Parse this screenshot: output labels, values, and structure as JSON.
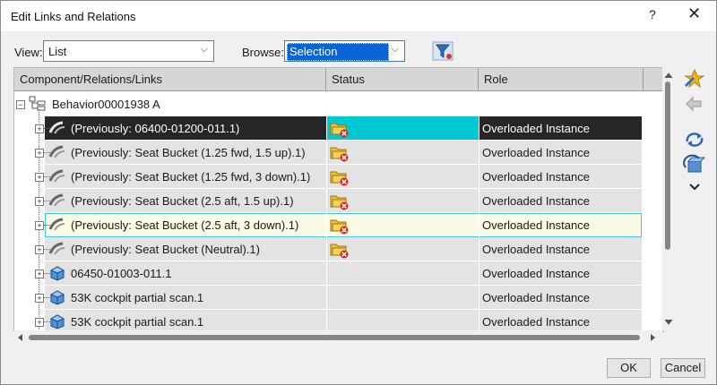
{
  "window": {
    "title": "Edit Links and Relations",
    "help_label": "?",
    "close_label": "✕"
  },
  "toolbar": {
    "view_label": "View:",
    "view_value": "List",
    "browse_label": "Browse:",
    "browse_value": "Selection",
    "filter_icon": "filter-icon"
  },
  "table": {
    "columns": [
      "Component/Relations/Links",
      "Status",
      "Role"
    ],
    "root": {
      "label": "Behavior00001938 A",
      "icon": "tree-structure-icon"
    },
    "rows": [
      {
        "name": "(Previously: 06400-01200-011.1)",
        "role": "Overloaded Instance",
        "icon": "broken-link-icon",
        "status": "folder-error-icon",
        "state": "selected"
      },
      {
        "name": "(Previously: Seat Bucket (1.25 fwd, 1.5 up).1)",
        "role": "Overloaded Instance",
        "icon": "broken-link-icon",
        "status": "folder-error-icon",
        "state": "normal"
      },
      {
        "name": "(Previously: Seat Bucket (1.25 fwd, 3 down).1)",
        "role": "Overloaded Instance",
        "icon": "broken-link-icon",
        "status": "folder-error-icon",
        "state": "normal"
      },
      {
        "name": "(Previously: Seat Bucket (2.5 aft, 1.5 up).1)",
        "role": "Overloaded Instance",
        "icon": "broken-link-icon",
        "status": "folder-error-icon",
        "state": "normal"
      },
      {
        "name": "(Previously: Seat Bucket (2.5 aft, 3 down).1)",
        "role": "Overloaded Instance",
        "icon": "broken-link-icon",
        "status": "folder-error-icon",
        "state": "hover"
      },
      {
        "name": "(Previously: Seat Bucket (Neutral).1)",
        "role": "Overloaded Instance",
        "icon": "broken-link-icon",
        "status": "folder-error-icon",
        "state": "normal"
      },
      {
        "name": "06450-01003-011.1",
        "role": "Overloaded Instance",
        "icon": "part-cube-icon",
        "status": "",
        "state": "normal"
      },
      {
        "name": "53K cockpit partial scan.1",
        "role": "Overloaded Instance",
        "icon": "part-cube-icon",
        "status": "",
        "state": "normal"
      },
      {
        "name": "53K cockpit partial scan.1",
        "role": "Overloaded Instance",
        "icon": "part-cube-icon",
        "status": "",
        "state": "normal"
      }
    ]
  },
  "side_buttons": [
    "wizard-star-icon",
    "replace-arrows-icon",
    "refresh-arrows-icon",
    "reload-component-icon",
    "chevron-down-icon"
  ],
  "buttons": {
    "ok": "OK",
    "cancel": "Cancel"
  },
  "colors": {
    "selection": "#00c8d2",
    "hover_border": "#3fc9d6",
    "hover_fill": "#fafae6",
    "row_gray": "#e3e3e3",
    "header": "#d6d6d6"
  }
}
